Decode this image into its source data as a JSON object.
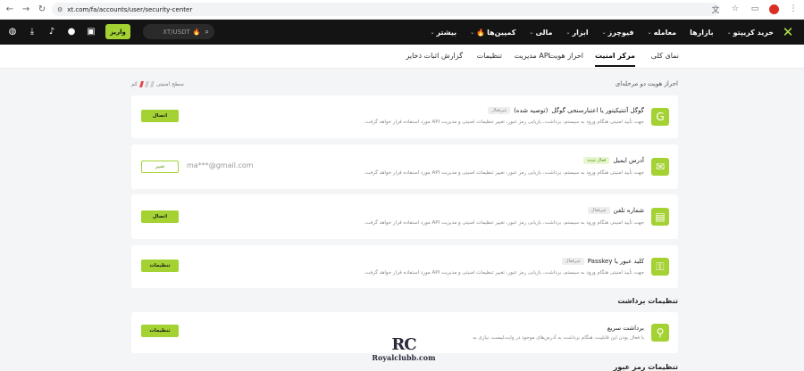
{
  "browser": {
    "url": "xt.com/fa/accounts/user/security-center"
  },
  "topnav": {
    "logo": "✕",
    "menu": [
      {
        "label": "خرید کریپتو",
        "chev": "⌄"
      },
      {
        "label": "بازارها",
        "chev": ""
      },
      {
        "label": "معامله",
        "chev": "⌄"
      },
      {
        "label": "فیوچرز",
        "chev": "⌄"
      },
      {
        "label": "ابزار",
        "chev": "⌄"
      },
      {
        "label": "مالی",
        "chev": "⌄"
      },
      {
        "label": "کمپین‌ها",
        "chev": "⌄",
        "fire": "🔥"
      },
      {
        "label": "بیشتر",
        "chev": "⌄"
      }
    ],
    "search_text": "XT/USDT",
    "search_fire": "🔥",
    "deposit_label": "واریز"
  },
  "subnav": {
    "tabs": [
      {
        "label": "نمای کلی",
        "active": false
      },
      {
        "label": "مرکز امنیت",
        "active": true
      },
      {
        "label": "احراز هویت",
        "active": false
      },
      {
        "label": "مدیریت API",
        "active": false
      },
      {
        "label": "تنظیمات",
        "active": false
      },
      {
        "label": "گزارش اثبات ذخایر",
        "active": false
      }
    ]
  },
  "security": {
    "section_title": "احراز هویت دو مرحله‌ای",
    "level_label": "سطح امنیتی",
    "level_value": "کم",
    "level_colors": [
      "#e5484d",
      "#cfcfcf",
      "#cfcfcf"
    ]
  },
  "cards": [
    {
      "title": "گوگل آتنتیکیتور یا اعتبارسنجی گوگل",
      "title_note": "(توصیه شده)",
      "badge": "غیرفعال",
      "badge_on": false,
      "desc_line1": "جهت تأیید امنیتی هنگام ورود به سیستم، برداشت، بازیابی رمز عبور، تغییر تنظیمات امنیتی و مدیریت API مورد استفاده قرار خواهد گرفت.",
      "button": "اتصال",
      "icon": "G",
      "icon_color": "#a4d233"
    },
    {
      "title": "آدرس ایمیل",
      "badge": "فعال شده",
      "badge_on": true,
      "desc_line1": "جهت تأیید امنیتی هنگام ورود به سیستم، برداشت، بازیابی رمز عبور، تغییر تنظیمات امنیتی و مدیریت API مورد استفاده قرار خواهد گرفت.",
      "value": "ma***@gmail.com",
      "button": "تغییر",
      "icon": "✉",
      "icon_color": "#a4d233"
    },
    {
      "title": "شماره تلفن",
      "badge": "غیرفعال",
      "badge_on": false,
      "desc_line1": "جهت تأیید امنیتی هنگام ورود به سیستم، برداشت، بازیابی رمز عبور، تغییر تنظیمات امنیتی و مدیریت API مورد استفاده قرار خواهد گرفت.",
      "button": "اتصال",
      "icon": "▤",
      "icon_color": "#a4d233"
    },
    {
      "title": "کلید عبور یا Passkey",
      "badge": "غیرفعال",
      "badge_on": false,
      "desc_line1": "جهت تأیید امنیتی هنگام ورود به سیستم، برداشت، بازیابی رمز عبور، تغییر تنظیمات امنیتی و مدیریت API مورد استفاده قرار خواهد گرفت.",
      "button": "تنظیمات",
      "icon": "⚿",
      "icon_color": "#a4d233"
    }
  ],
  "withdraw": {
    "heading": "تنظیمات برداشت",
    "title": "برداشت سریع",
    "desc": "با فعال بودن این قابلیت، هنگام برداشت به آدرس‌های موجود در وایت‌لیست، نیازی به",
    "button": "تنظیمات",
    "icon": "⚲",
    "icon_color": "#a4d233"
  },
  "password_heading": "تنظیمات رمز عبور",
  "watermark": {
    "mark": "RC",
    "text": "Royalclubb.com"
  }
}
